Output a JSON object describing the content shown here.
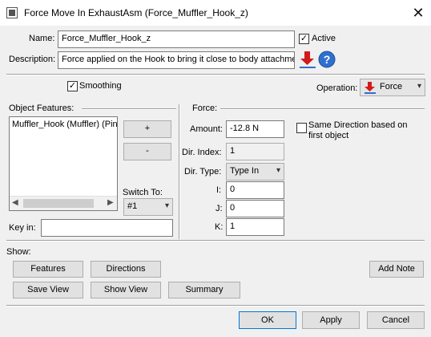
{
  "window": {
    "title": "Force Move In ExhaustAsm (Force_Muffler_Hook_z)"
  },
  "header": {
    "name_label": "Name:",
    "name_value": "Force_Muffler_Hook_z",
    "active_label": "Active",
    "active_checked": true,
    "description_label": "Description:",
    "description_value": "Force applied on the Hook to bring it close to body attachme"
  },
  "options": {
    "smoothing_label": "Smoothing",
    "smoothing_checked": true,
    "operation_label": "Operation:",
    "operation_value": "Force"
  },
  "object_features": {
    "group_label": "Object Features:",
    "list_items": [
      "Muffler_Hook (Muffler) (Pin"
    ],
    "add_label": "+",
    "remove_label": "-",
    "switch_to_label": "Switch To:",
    "switch_to_value": "#1",
    "keyin_label": "Key in:",
    "keyin_value": ""
  },
  "force": {
    "group_label": "Force:",
    "amount_label": "Amount:",
    "amount_value": "-12.8 N",
    "same_direction_label": "Same Direction based on first object",
    "same_direction_checked": false,
    "dir_index_label": "Dir. Index:",
    "dir_index_value": "1",
    "dir_type_label": "Dir. Type:",
    "dir_type_value": "Type In",
    "i_label": "I:",
    "i_value": "0",
    "j_label": "J:",
    "j_value": "0",
    "k_label": "K:",
    "k_value": "1"
  },
  "show": {
    "group_label": "Show:",
    "features_label": "Features",
    "directions_label": "Directions",
    "add_note_label": "Add Note",
    "save_view_label": "Save View",
    "show_view_label": "Show View",
    "summary_label": "Summary"
  },
  "footer": {
    "ok_label": "OK",
    "apply_label": "Apply",
    "cancel_label": "Cancel"
  },
  "colors": {
    "accent": "#0078d7",
    "arrow_red": "#d11a1a",
    "help_blue": "#2f6fce"
  }
}
